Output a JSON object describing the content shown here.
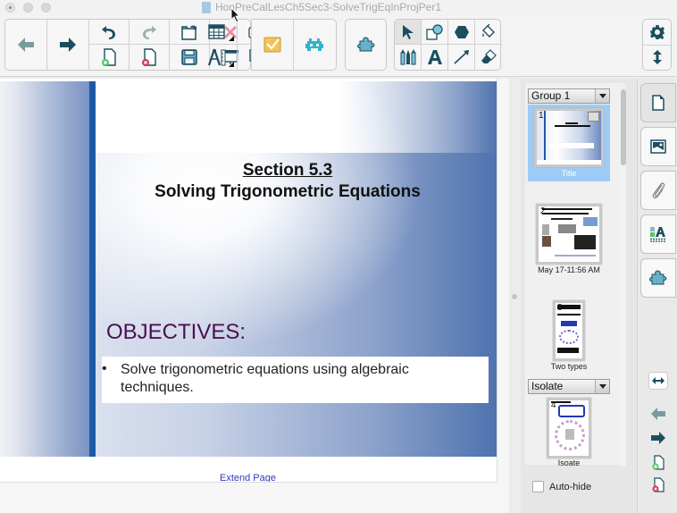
{
  "window": {
    "title": "HonPreCalLesCh5Sec3-SolveTrigEqInProjPer1"
  },
  "toolbar": {
    "back": "back-arrow",
    "forward": "forward-arrow",
    "undo": "undo",
    "redo": "redo",
    "open_file": "open-file",
    "delete": "delete",
    "table": "insert-table",
    "screen_capture": "screen-capture",
    "add_page": "add-page",
    "delete_page": "delete-page",
    "save": "save",
    "screen_shade": "screen-shade",
    "measurement_tools": "measurement-tools",
    "document_camera": "document-camera",
    "response": "response",
    "add_ons": "add-ons",
    "lesson_activity": "lesson-activity-builder",
    "select": "select",
    "shapes": "shapes",
    "regular_polygons": "regular-polygons",
    "fill": "fill",
    "pens": "pens",
    "text": "text",
    "lines": "lines",
    "eraser": "eraser",
    "settings": "settings",
    "move_toolbar": "move-toolbar"
  },
  "slide": {
    "section": "Section 5.3",
    "subtitle": "Solving Trigonometric Equations",
    "objectives_heading": "OBJECTIVES:",
    "bullet": "•",
    "objective": "Solve trigonometric equations using algebraic techniques.",
    "extend_page": "Extend Page"
  },
  "page_sorter": {
    "groups": [
      {
        "name": "Group 1"
      },
      {
        "name": "Isolate"
      }
    ],
    "pages": [
      {
        "number": "1",
        "label": "Title",
        "selected": true
      },
      {
        "number": "2",
        "label": "May 17-11:56 AM",
        "selected": false
      },
      {
        "number": "3",
        "label": "Two types",
        "selected": false
      },
      {
        "number": "4",
        "label": "Isoate",
        "selected": false
      }
    ],
    "auto_hide_label": "Auto-hide",
    "auto_hide_checked": false
  },
  "side_tabs": [
    {
      "name": "page-sorter",
      "active": true
    },
    {
      "name": "gallery",
      "active": false
    },
    {
      "name": "attachments",
      "active": false
    },
    {
      "name": "properties",
      "active": false
    },
    {
      "name": "add-ons",
      "active": false
    }
  ],
  "colors": {
    "accent_teal": "#1b4f5e",
    "slide_blue": "#1d5aa6",
    "objectives_purple": "#4a1050",
    "selection_blue": "#9ecbf5",
    "link_blue": "#2d3bbf"
  }
}
